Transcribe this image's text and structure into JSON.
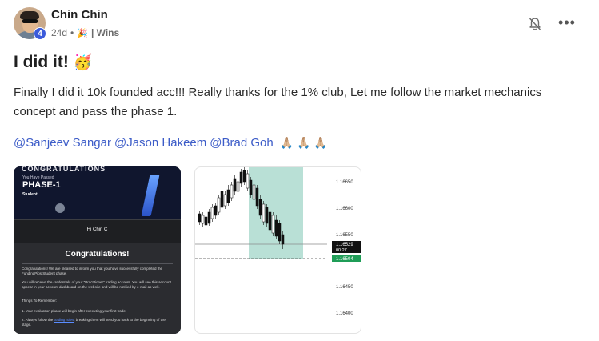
{
  "author": {
    "name": "Chin Chin",
    "level": "4",
    "time": "24d",
    "separator": "•",
    "category": "| Wins"
  },
  "post": {
    "title": "I did it!",
    "title_emoji": "🥳",
    "body": "Finally I did it 10k founded acc!!! Really thanks for the 1% club, Let me follow the market mechanics concept and pass the phase 1.",
    "mentions": [
      "@Sanjeev Sangar",
      "@Jason Hakeem",
      "@Brad Goh"
    ],
    "reaction_emoji": "🙏🏼 🙏🏼 🙏🏼"
  },
  "attachment1": {
    "banner_title": "CONGRATULATIONS",
    "banner_sub": "You Have Passed",
    "phase": "PHASE-1",
    "role": "Student",
    "greeting": "Hi Chin C",
    "heading": "Congratulations!",
    "para1": "Congratulations! We are pleased to inform you that you have successfully completed the FundingPips Student phase.",
    "para2": "You will receive the credentials of your \"Practitioner\" trading account. You will see this account appear in your account dashboard on the website and will be notified by e-mail as well.",
    "para3": "Things To Remember:",
    "item1": "1.   Your evaluation phase will begin after executing your first trade.",
    "item2_pre": "2.   Always follow the ",
    "item2_link": "trading rules",
    "item2_post": ", breaking them will send you back to the beginning of the stage."
  },
  "attachment2": {
    "price_labels": [
      "1.16650",
      "1.16600",
      "1.16550",
      "1.16450",
      "1.16400"
    ],
    "current_price": "1.16529",
    "countdown": "00:27",
    "bid_price": "1.16504"
  },
  "colors": {
    "mention": "#3c5cc8",
    "level_badge": "#3b5bdb",
    "highlight": "#b9e0d6"
  },
  "icons": {
    "bell": "bell-off-icon",
    "more": "more-horizontal-icon",
    "category": "party-popper-icon"
  }
}
